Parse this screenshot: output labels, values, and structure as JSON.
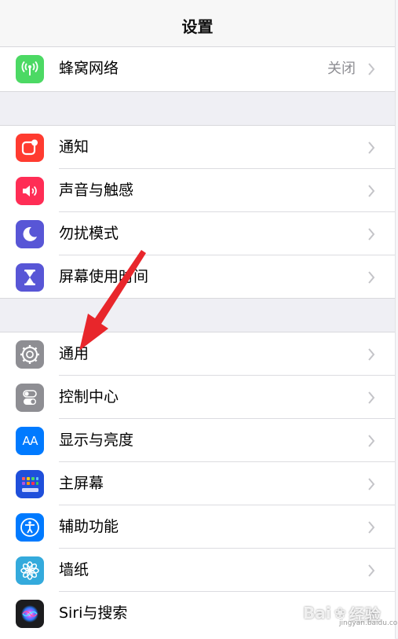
{
  "header": {
    "title": "设置"
  },
  "colors": {
    "cellular": "#4cd964",
    "notifications": "#ff3b30",
    "sounds": "#ff2d55",
    "dnd": "#5856d6",
    "screen_time": "#5856d6",
    "general": "#8e8e93",
    "control_center": "#8e8e93",
    "display": "#007aff",
    "home_screen": "#1f4fdb",
    "accessibility": "#007aff",
    "wallpaper": "#34aadc",
    "siri": "#1c1c1e",
    "annotation_arrow": "#e8262b"
  },
  "group1": [
    {
      "label": "蜂窝网络",
      "value": "关闭",
      "icon": "antenna-icon"
    }
  ],
  "group2": [
    {
      "label": "通知",
      "icon": "notification-icon"
    },
    {
      "label": "声音与触感",
      "icon": "speaker-icon"
    },
    {
      "label": "勿扰模式",
      "icon": "moon-icon"
    },
    {
      "label": "屏幕使用时间",
      "icon": "hourglass-icon"
    }
  ],
  "group3": [
    {
      "label": "通用",
      "icon": "gear-icon"
    },
    {
      "label": "控制中心",
      "icon": "toggles-icon"
    },
    {
      "label": "显示与亮度",
      "icon": "text-size-icon",
      "icon_text": "AA"
    },
    {
      "label": "主屏幕",
      "icon": "grid-icon"
    },
    {
      "label": "辅助功能",
      "icon": "accessibility-icon"
    },
    {
      "label": "墙纸",
      "icon": "flower-icon"
    },
    {
      "label": "Siri与搜索",
      "icon": "siri-icon"
    }
  ],
  "watermark": {
    "brand": "Bai",
    "suffix": "经验",
    "sub": "jingyan.baidu.com"
  }
}
